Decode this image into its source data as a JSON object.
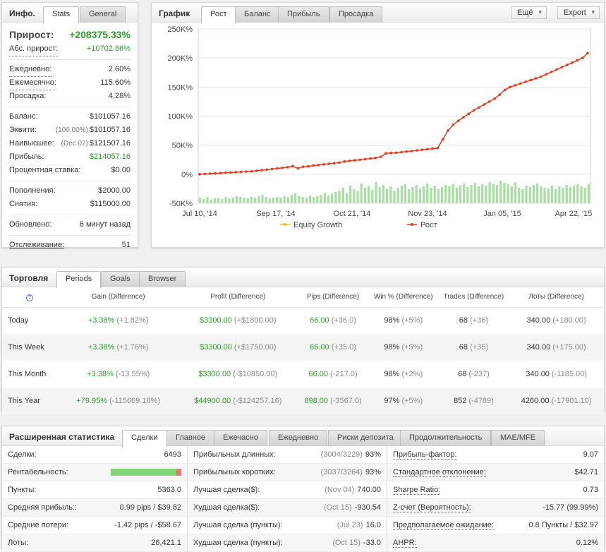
{
  "info": {
    "title": "Инфо.",
    "tabs": [
      "Stats",
      "General"
    ],
    "gain_label": "Прирост:",
    "gain_value": "+208375.33%",
    "abs_gain_label": "Абс. прирост:",
    "abs_gain_value": "+10702.86%",
    "daily_label": "Ежедневно:",
    "daily_value": "2.60%",
    "monthly_label": "Ежемесячно:",
    "monthly_value": "115.60%",
    "drawdown_label": "Просадка:",
    "drawdown_value": "4.28%",
    "balance_label": "Баланс:",
    "balance_value": "$101057.16",
    "equity_label": "Эквити:",
    "equity_pct": "(100.00%)",
    "equity_value": "$101057.16",
    "highest_label": "Наивысшее:",
    "highest_date": "(Dec 02)",
    "highest_value": "$121507.16",
    "profit_label": "Прибыль:",
    "profit_value": "$214057.16",
    "interest_label": "Процентная ставка:",
    "interest_value": "$0.00",
    "deposits_label": "Пополнения:",
    "deposits_value": "$2000.00",
    "withdrawals_label": "Снятия:",
    "withdrawals_value": "$115000.00",
    "updated_label": "Обновлено:",
    "updated_value": "6 минут назад",
    "tracking_label": "Отслеживание:",
    "tracking_value": "51"
  },
  "chart_panel": {
    "title": "График",
    "tabs": [
      "Рост",
      "Баланс",
      "Прибыль",
      "Просадка"
    ],
    "more_label": "Ещё",
    "export_label": "Export",
    "legend": [
      "Equity Growth",
      "Рост"
    ]
  },
  "chart_data": {
    "type": "line",
    "y_ticks": [
      "250K%",
      "200K%",
      "150K%",
      "100K%",
      "50K%",
      "0%",
      "-50K%"
    ],
    "y_tick_values": [
      250000,
      200000,
      150000,
      100000,
      50000,
      0,
      -50000
    ],
    "x_ticks": [
      "Jul 10, '14",
      "Sep 17, '14",
      "Oct 21, '14",
      "Nov 23, '14",
      "Jan 05, '15",
      "Apr 22, '15"
    ],
    "ylim": [
      -50000,
      250000
    ],
    "series": [
      {
        "name": "Рост",
        "color": "#e8391d",
        "values": [
          0,
          500,
          1000,
          1500,
          2000,
          2500,
          3000,
          3500,
          4000,
          4500,
          5000,
          6000,
          7000,
          8000,
          9000,
          10000,
          11000,
          12000,
          14000,
          10000,
          13000,
          13500,
          15000,
          16000,
          17000,
          18000,
          19000,
          20000,
          22000,
          23000,
          24000,
          25000,
          26000,
          27000,
          28000,
          30000,
          36000,
          36500,
          37000,
          38000,
          39000,
          40000,
          41000,
          42000,
          43000,
          44000,
          45000,
          60000,
          75000,
          85000,
          92000,
          98000,
          104000,
          110000,
          115000,
          120000,
          125000,
          130000,
          137000,
          145000,
          150000,
          153000,
          156000,
          159000,
          162000,
          165000,
          168000,
          172000,
          176000,
          180000,
          184000,
          188000,
          192000,
          196000,
          200000,
          208375
        ]
      },
      {
        "name": "Equity Growth",
        "color": "#f0c020",
        "values": []
      }
    ],
    "volume_bars": [
      8,
      6,
      9,
      5,
      7,
      8,
      6,
      9,
      7,
      8,
      10,
      9,
      8,
      7,
      9,
      8,
      10,
      12,
      9,
      7,
      8,
      9,
      8,
      10,
      9,
      12,
      14,
      10,
      9,
      8,
      11,
      9,
      10,
      12,
      15,
      11,
      14,
      16,
      18,
      22,
      14,
      25,
      20,
      17,
      28,
      22,
      24,
      19,
      30,
      23,
      26,
      20,
      24,
      18,
      22,
      25,
      27,
      20,
      23,
      26,
      21,
      24,
      28,
      22,
      25,
      20,
      23,
      26,
      24,
      27,
      22,
      25,
      28,
      23,
      26,
      29,
      24,
      27,
      25,
      30,
      28,
      26,
      32,
      29,
      27,
      24,
      30,
      22,
      20,
      25,
      23,
      26,
      28,
      24,
      22,
      21,
      25,
      20,
      24,
      22,
      26,
      23,
      25,
      27,
      24,
      22,
      28
    ]
  },
  "trading": {
    "title": "Торговля",
    "tabs": [
      "Periods",
      "Goals",
      "Browser"
    ],
    "headers": [
      "Gain (Difference)",
      "Profit (Difference)",
      "Pips (Difference)",
      "Win % (Difference)",
      "Trades (Difference)",
      "Лоты (Difference)"
    ],
    "rows": [
      {
        "period": "Today",
        "gain": "+3.38%",
        "gain_diff": "(+1.82%)",
        "profit": "$3300.00",
        "profit_diff": "(+$1800.00)",
        "pips": "66.00",
        "pips_diff": "(+36.0)",
        "win": "98%",
        "win_diff": "(+5%)",
        "trades": "68",
        "trades_diff": "(+36)",
        "lots": "340.00",
        "lots_diff": "(+180.00)"
      },
      {
        "period": "This Week",
        "gain": "+3.38%",
        "gain_diff": "(+1.76%)",
        "profit": "$3300.00",
        "profit_diff": "(+$1750.00)",
        "pips": "66.00",
        "pips_diff": "(+35.0)",
        "win": "98%",
        "win_diff": "(+5%)",
        "trades": "68",
        "trades_diff": "(+35)",
        "lots": "340.00",
        "lots_diff": "(+175.00)"
      },
      {
        "period": "This Month",
        "gain": "+3.38%",
        "gain_diff": "(-13.55%)",
        "profit": "$3300.00",
        "profit_diff": "(-$10850.00)",
        "pips": "66.00",
        "pips_diff": "(-217.0)",
        "win": "98%",
        "win_diff": "(+2%)",
        "trades": "68",
        "trades_diff": "(-237)",
        "lots": "340.00",
        "lots_diff": "(-1185.00)"
      },
      {
        "period": "This Year",
        "gain": "+79.95%",
        "gain_diff": "(-115669.16%)",
        "profit": "$44900.00",
        "profit_diff": "(-$124257.16)",
        "pips": "898.00",
        "pips_diff": "(-3567.0)",
        "win": "97%",
        "win_diff": "(+5%)",
        "trades": "852",
        "trades_diff": "(-4789)",
        "lots": "4260.00",
        "lots_diff": "(-17901.10)"
      }
    ]
  },
  "extended": {
    "title": "Расширенная статистика",
    "tabs": [
      "Сделки",
      "Главное",
      "Ежечасно",
      "Ежедневно",
      "Риски депозита",
      "Продолжительность",
      "MAE/MFE"
    ],
    "profitability_ratio": 0.93,
    "col1": [
      {
        "label": "Сделки:",
        "value": "6493"
      },
      {
        "label": "Рентабельность:",
        "value": ""
      },
      {
        "label": "Пункты:",
        "value": "5363.0"
      },
      {
        "label": "Средняя прибыль::",
        "value": "0.99 pips / $39.82"
      },
      {
        "label": "Средние потери:",
        "value": "-1.42 pips / -$58.67"
      },
      {
        "label": "Лоты:",
        "value": "26,421.1"
      }
    ],
    "col2": [
      {
        "label": "Прибыльных длинных:",
        "muted": "(3004/3229)",
        "value": "93%"
      },
      {
        "label": "Прибыльных коротких:",
        "muted": "(3037/3264)",
        "value": "93%"
      },
      {
        "label": "Лучшая сделка($):",
        "muted": "(Nov 04)",
        "value": "740.00"
      },
      {
        "label": "Худшая сделка($):",
        "muted": "(Oct 15)",
        "value": "-930.54"
      },
      {
        "label": "Лучшая сделка (пункты):",
        "muted": "(Jul 23)",
        "value": "16.0"
      },
      {
        "label": "Худшая сделка (пункты):",
        "muted": "(Oct 15)",
        "value": "-33.0"
      }
    ],
    "col3": [
      {
        "label": "Прибыль-фактор:",
        "value": "9.07"
      },
      {
        "label": "Стандартное отклонение:",
        "value": "$42.71"
      },
      {
        "label": "Sharpe Ratio:",
        "value": "0.73"
      },
      {
        "label": "Z-счет (Вероятность):",
        "value": "-15.77 (99.99%)"
      },
      {
        "label": "Предполагаемое ожидание:",
        "value": "0.8 Пункты / $32.97"
      },
      {
        "label": "AHPR:",
        "value": "0.12%"
      }
    ]
  }
}
